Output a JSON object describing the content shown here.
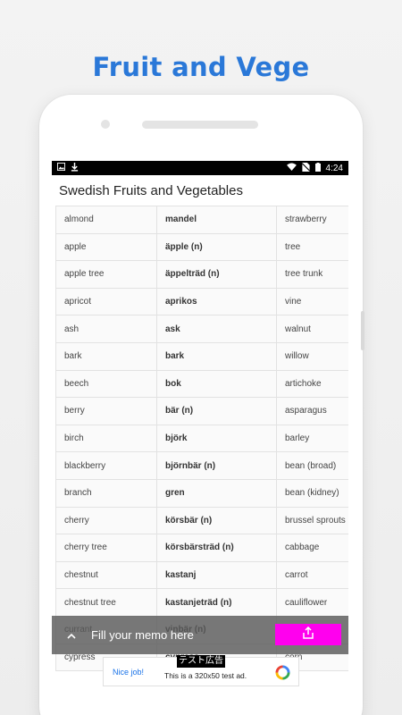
{
  "promo": {
    "title": "Fruit and Vege"
  },
  "statusbar": {
    "time": "4:24"
  },
  "app": {
    "title": "Swedish Fruits and Vegetables"
  },
  "rows": [
    {
      "en": "almond",
      "sv": "mandel",
      "en2": "strawberry"
    },
    {
      "en": "apple",
      "sv": "äpple (n)",
      "en2": "tree"
    },
    {
      "en": "apple tree",
      "sv": "äppelträd (n)",
      "en2": "tree trunk"
    },
    {
      "en": "apricot",
      "sv": "aprikos",
      "en2": "vine"
    },
    {
      "en": "ash",
      "sv": "ask",
      "en2": "walnut"
    },
    {
      "en": "bark",
      "sv": "bark",
      "en2": "willow"
    },
    {
      "en": "beech",
      "sv": "bok",
      "en2": "artichoke"
    },
    {
      "en": "berry",
      "sv": "bär (n)",
      "en2": "asparagus"
    },
    {
      "en": "birch",
      "sv": "björk",
      "en2": "barley"
    },
    {
      "en": "blackberry",
      "sv": "björnbär (n)",
      "en2": "bean (broad)"
    },
    {
      "en": "branch",
      "sv": "gren",
      "en2": "bean (kidney)"
    },
    {
      "en": "cherry",
      "sv": "körsbär (n)",
      "en2": "brussel sprouts"
    },
    {
      "en": "cherry tree",
      "sv": "körsbärsträd (n)",
      "en2": "cabbage"
    },
    {
      "en": "chestnut",
      "sv": "kastanj",
      "en2": "carrot"
    },
    {
      "en": "chestnut tree",
      "sv": "kastanjeträd (n)",
      "en2": "cauliflower"
    },
    {
      "en": "currant",
      "sv": "vinbär (n)",
      "en2": "celery"
    },
    {
      "en": "cypress",
      "sv": "cypress",
      "en2": "corn"
    }
  ],
  "memo": {
    "placeholder": "Fill your memo here"
  },
  "ad": {
    "badge": "テスト広告",
    "nice": "Nice job!",
    "text": "This is a 320x50 test ad."
  }
}
